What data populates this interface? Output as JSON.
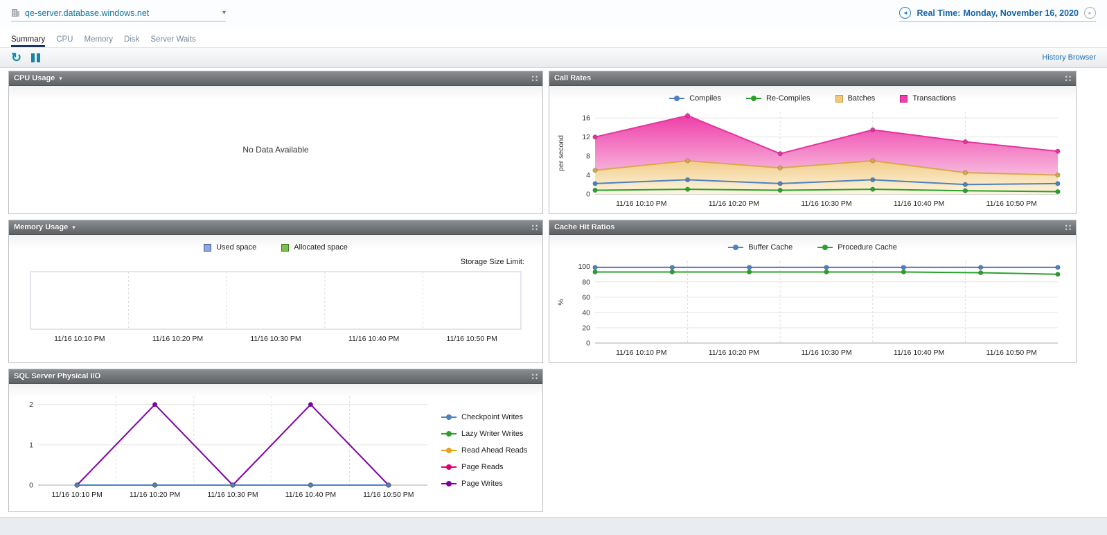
{
  "topbar": {
    "server_name": "qe-server.database.windows.net",
    "realtime_label": "Real Time:",
    "realtime_date": "Monday, November 16, 2020"
  },
  "icons": {
    "refresh": "↻",
    "caret_down": "▾",
    "panel_grip": "∷",
    "dropdown_chevron": "▾",
    "back_arrow": "◄",
    "forward_arrow": "▸"
  },
  "tabs": [
    {
      "label": "Summary"
    },
    {
      "label": "CPU"
    },
    {
      "label": "Memory"
    },
    {
      "label": "Disk"
    },
    {
      "label": "Server Waits"
    }
  ],
  "toolbar": {
    "history_browser_label": "History Browser"
  },
  "panels": {
    "cpu": {
      "title": "CPU Usage",
      "no_data": "No Data Available"
    },
    "call_rates": {
      "title": "Call Rates"
    },
    "memory": {
      "title": "Memory Usage",
      "storage_limit_label": "Storage Size Limit:"
    },
    "cache": {
      "title": "Cache Hit Ratios"
    },
    "physical_io": {
      "title": "SQL Server Physical I/O"
    }
  },
  "chart_data": [
    {
      "id": "call-rates",
      "type": "area",
      "title": "Call Rates",
      "xlabel": "",
      "ylabel": "per second",
      "ylim": [
        0,
        17.2
      ],
      "yticks": [
        0,
        4,
        8,
        12,
        16
      ],
      "x_labels": [
        "11/16 10:10 PM",
        "11/16 10:20 PM",
        "11/16 10:30 PM",
        "11/16 10:40 PM",
        "11/16 10:50 PM"
      ],
      "series": [
        {
          "name": "Transactions",
          "color": "#e333a0",
          "fill": [
            "#ee3fa8",
            "#fbdff0"
          ],
          "values": [
            12,
            16.5,
            8.5,
            13.5,
            11,
            9
          ]
        },
        {
          "name": "Batches",
          "color": "#d9a84e",
          "fill": [
            "#f2cd8a",
            "#fdf4e0"
          ],
          "values": [
            5,
            7,
            5.5,
            7,
            4.5,
            4
          ]
        },
        {
          "name": "Compiles",
          "color": "#4f81bd",
          "values": [
            2.2,
            3,
            2.2,
            3,
            2,
            2.2
          ]
        },
        {
          "name": "Re-Compiles",
          "color": "#2ca02c",
          "values": [
            0.8,
            1,
            0.8,
            1,
            0.7,
            0.5
          ]
        }
      ],
      "legend": [
        {
          "label": "Compiles",
          "color": "#4f81bd",
          "marker": "line-dot"
        },
        {
          "label": "Re-Compiles",
          "color": "#2ca02c",
          "marker": "line-dot"
        },
        {
          "label": "Batches",
          "color": "#f0c87e",
          "border": "#c79b3b",
          "marker": "square"
        },
        {
          "label": "Transactions",
          "color": "#f23fae",
          "border": "#c0107e",
          "marker": "square"
        }
      ]
    },
    {
      "id": "memory-usage",
      "type": "line",
      "title": "Memory Usage",
      "xlabel": "",
      "ylabel": "",
      "x_labels": [
        "11/16 10:10 PM",
        "11/16 10:20 PM",
        "11/16 10:30 PM",
        "11/16 10:40 PM",
        "11/16 10:50 PM"
      ],
      "series": [],
      "legend": [
        {
          "label": "Used space",
          "color": "#8fa7de",
          "border": "#44599e",
          "marker": "square"
        },
        {
          "label": "Allocated space",
          "color": "#7cbf4e",
          "border": "#3f7a1e",
          "marker": "square"
        }
      ]
    },
    {
      "id": "cache-hit",
      "type": "line",
      "title": "Cache Hit Ratios",
      "xlabel": "",
      "ylabel": "%",
      "ylim": [
        0,
        107
      ],
      "yticks": [
        0,
        20,
        40,
        60,
        80,
        100
      ],
      "x_labels": [
        "11/16 10:10 PM",
        "11/16 10:20 PM",
        "11/16 10:30 PM",
        "11/16 10:40 PM",
        "11/16 10:50 PM"
      ],
      "series": [
        {
          "name": "Buffer Cache",
          "color": "#4f81bd",
          "values": [
            99,
            99,
            99,
            99,
            99,
            99,
            99
          ]
        },
        {
          "name": "Procedure Cache",
          "color": "#2ca02c",
          "values": [
            93,
            93,
            93,
            93,
            93,
            92,
            90
          ]
        }
      ],
      "legend": [
        {
          "label": "Buffer Cache",
          "color": "#4f81bd",
          "marker": "line-dot"
        },
        {
          "label": "Procedure Cache",
          "color": "#2ca02c",
          "marker": "line-dot"
        }
      ]
    },
    {
      "id": "physical-io",
      "type": "line",
      "title": "SQL Server Physical I/O",
      "xlabel": "",
      "ylabel": "",
      "ylim": [
        0,
        2.2
      ],
      "yticks": [
        0,
        1,
        2
      ],
      "x_labels": [
        "11/16 10:10 PM",
        "11/16 10:20 PM",
        "11/16 10:30 PM",
        "11/16 10:40 PM",
        "11/16 10:50 PM"
      ],
      "series": [
        {
          "name": "Read Ahead Reads",
          "color": "#e8a020",
          "values": [
            0,
            0,
            0,
            0,
            0
          ]
        },
        {
          "name": "Page Reads",
          "color": "#dd0077",
          "values": [
            0,
            0,
            0,
            0,
            0
          ]
        },
        {
          "name": "Lazy Writer Writes",
          "color": "#2ca02c",
          "values": [
            0,
            0,
            0,
            0,
            0
          ]
        },
        {
          "name": "Page Writes",
          "color": "#8000a8",
          "values": [
            0,
            2,
            0,
            2,
            0
          ]
        },
        {
          "name": "Checkpoint Writes",
          "color": "#4f81bd",
          "values": [
            0,
            0,
            0,
            0,
            0
          ]
        }
      ],
      "legend": [
        {
          "label": "Checkpoint Writes",
          "color": "#4f81bd",
          "marker": "line-dot"
        },
        {
          "label": "Lazy Writer Writes",
          "color": "#2ca02c",
          "marker": "line-dot"
        },
        {
          "label": "Read Ahead Reads",
          "color": "#e8a020",
          "marker": "line-dot"
        },
        {
          "label": "Page Reads",
          "color": "#dd0077",
          "marker": "line-dot"
        },
        {
          "label": "Page Writes",
          "color": "#8000a8",
          "marker": "line-dot"
        }
      ]
    }
  ]
}
